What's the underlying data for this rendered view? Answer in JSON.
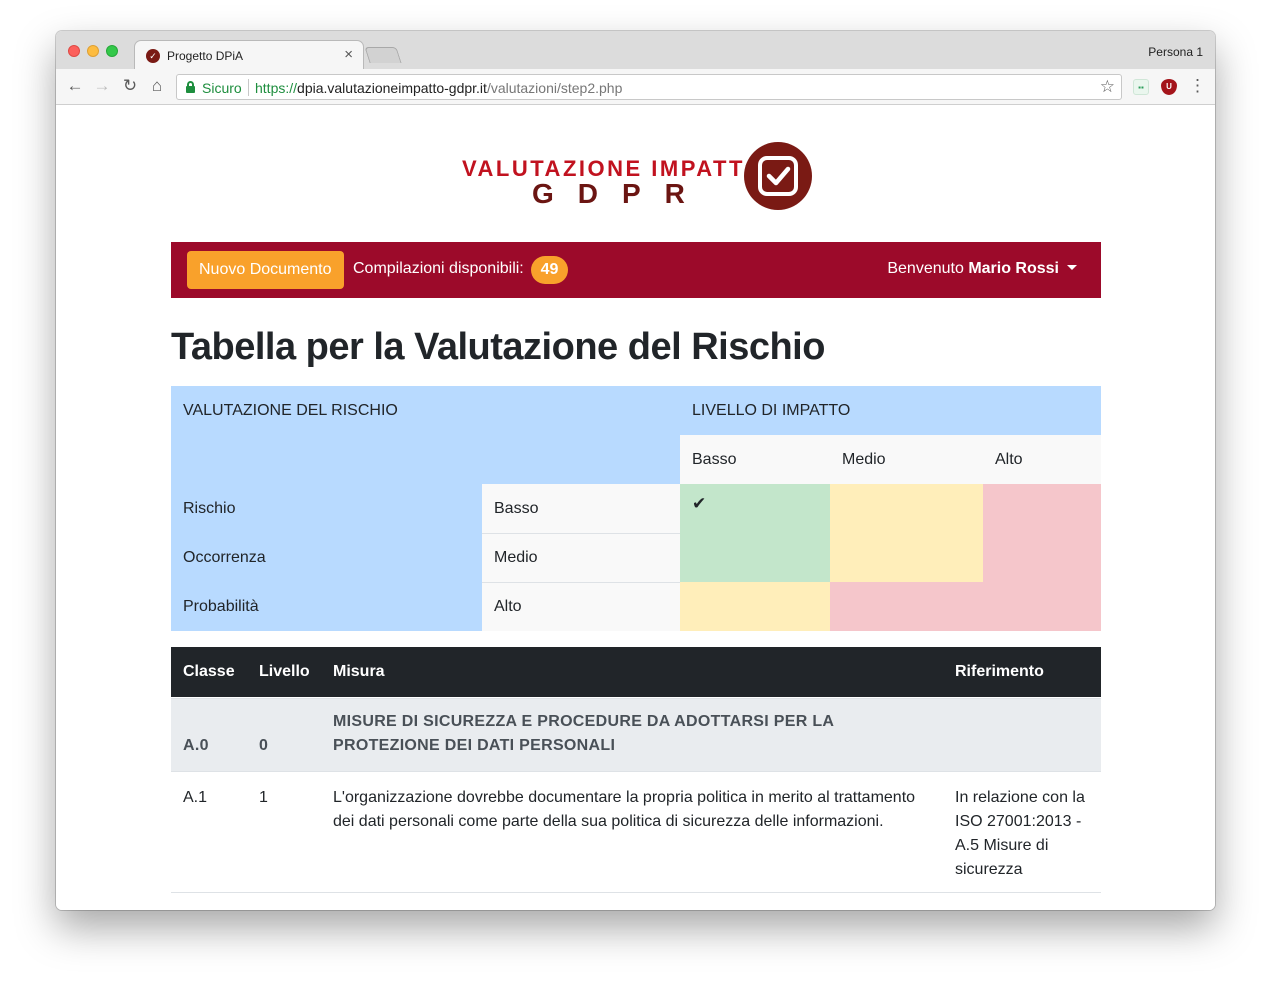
{
  "browser": {
    "tab_title": "Progetto DPiA",
    "profile": "Persona 1",
    "secure_label": "Sicuro",
    "url_scheme": "https://",
    "url_host": "dpia.valutazioneimpatto-gdpr.it",
    "url_path": "/valutazioni/step2.php"
  },
  "logo": {
    "line1": "VALUTAZIONE IMPATTO",
    "line2": "GDPR"
  },
  "navbar": {
    "new_document": "Nuovo Documento",
    "available_label": "Compilazioni disponibili:",
    "available_count": "49",
    "welcome_prefix": "Benvenuto",
    "user_name": "Mario Rossi"
  },
  "page_title": "Tabella per la Valutazione del Rischio",
  "risk_matrix": {
    "header_left": "VALUTAZIONE DEL RISCHIO",
    "header_right": "LIVELLO DI IMPATTO",
    "impact_levels": [
      "Basso",
      "Medio",
      "Alto"
    ],
    "rows": [
      {
        "label": "Rischio",
        "level": "Basso"
      },
      {
        "label": "Occorrenza",
        "level": "Medio"
      },
      {
        "label": "Probabilità",
        "level": "Alto"
      }
    ],
    "checkmark": "✔",
    "colors": {
      "header_bg": "#b8daff",
      "green": "#c3e6cb",
      "yellow": "#ffeeba",
      "red": "#f5c6cb"
    }
  },
  "measures_table": {
    "columns": [
      "Classe",
      "Livello",
      "Misura",
      "Riferimento"
    ],
    "group": {
      "classe": "A.0",
      "livello": "0",
      "misura_line1": "MISURE DI SICUREZZA E PROCEDURE DA ADOTTARSI PER LA",
      "misura_line2": "PROTEZIONE DEI DATI PERSONALI"
    },
    "rows": [
      {
        "classe": "A.1",
        "livello": "1",
        "misura_line1": "L'organizzazione dovrebbe documentare la propria politica in merito al trattamento",
        "misura_line2": "dei dati personali come parte della sua politica di sicurezza delle informazioni.",
        "riferimento_line1": "In relazione con la",
        "riferimento_line2": "ISO 27001:2013 -",
        "riferimento_line3": "A.5 Misure di",
        "riferimento_line4": "sicurezza"
      }
    ]
  },
  "theme": {
    "brand_dark_red": "#9c0a2a",
    "accent_orange": "#f9a12b"
  }
}
